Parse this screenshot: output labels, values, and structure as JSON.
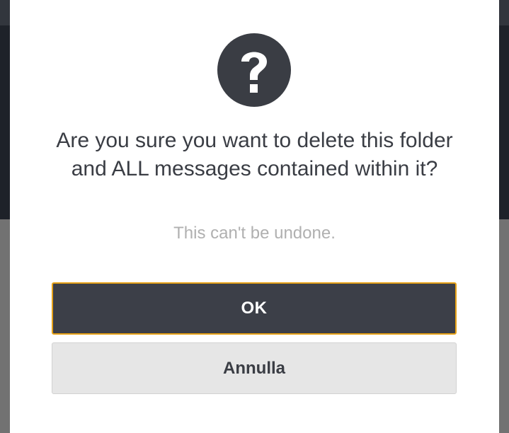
{
  "dialog": {
    "icon": "question-circle-icon",
    "title": "Are you sure you want to delete this folder and ALL messages contained within it?",
    "subtitle": "This can't be undone.",
    "confirm_label": "OK",
    "cancel_label": "Annulla"
  },
  "colors": {
    "icon": "#3a3d44",
    "confirm_background": "#3c3f48",
    "confirm_border_focus": "#e6a117",
    "cancel_background": "#e6e6e6",
    "subtitle_text": "#b0b0b0",
    "overlay": "#727272"
  }
}
